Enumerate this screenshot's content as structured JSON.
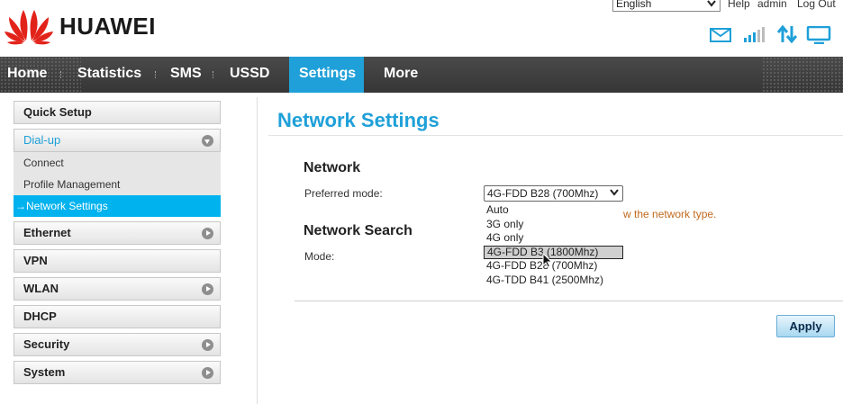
{
  "header": {
    "brand": "HUAWEI",
    "language": "English",
    "links": {
      "help": "Help",
      "admin": "admin",
      "logout": "Log Out"
    },
    "icons": [
      "mail-icon",
      "signal-icon",
      "data-transfer-icon",
      "monitor-icon"
    ]
  },
  "nav": {
    "items": [
      "Home",
      "Statistics",
      "SMS",
      "USSD",
      "Settings",
      "More"
    ],
    "active": "Settings"
  },
  "sidebar": {
    "quick_setup": "Quick Setup",
    "dialup": "Dial-up",
    "dialup_sub": [
      "Connect",
      "Profile Management",
      "Network Settings"
    ],
    "ethernet": "Ethernet",
    "vpn": "VPN",
    "wlan": "WLAN",
    "dhcp": "DHCP",
    "security": "Security",
    "system": "System"
  },
  "main": {
    "title": "Network Settings",
    "network_section": "Network",
    "preferred_mode_label": "Preferred mode:",
    "preferred_mode_value": "4G-FDD B28 (700Mhz)",
    "mode_options": [
      "Auto",
      "3G only",
      "4G only",
      "4G-FDD B3 (1800Mhz)",
      "4G-FDD B28 (700Mhz)",
      "4G-TDD B41 (2500Mhz)"
    ],
    "highlighted_option": "4G-FDD B3 (1800Mhz)",
    "hint": "w the network type.",
    "search_section": "Network Search",
    "mode_label": "Mode:",
    "apply": "Apply"
  },
  "colors": {
    "accent": "#1fa0d8",
    "navbar": "#3e3e3e",
    "active_sub": "#00b2ee",
    "hint": "#c06a1e"
  }
}
